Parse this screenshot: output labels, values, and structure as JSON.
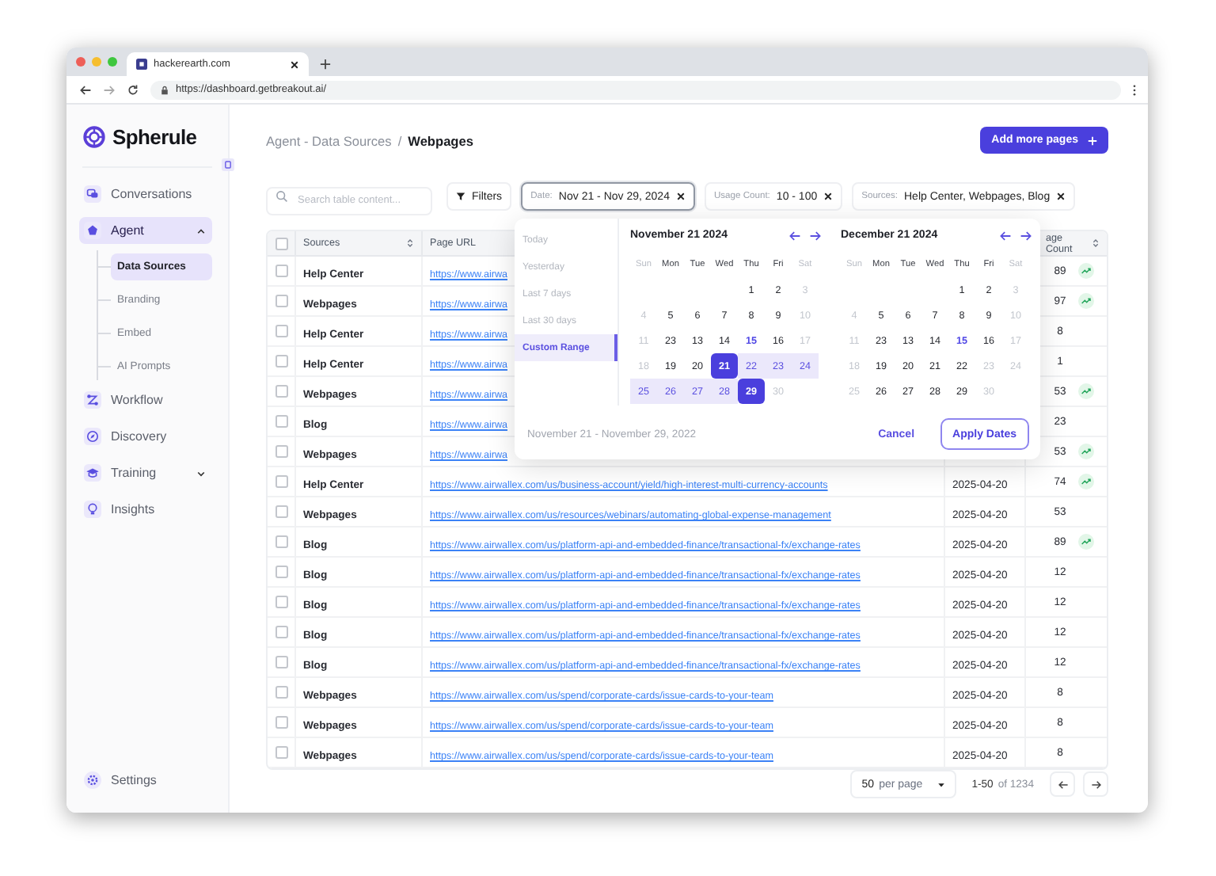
{
  "browser": {
    "tab_title": "hackerearth.com",
    "url": "https://dashboard.getbreakout.ai/"
  },
  "sidebar": {
    "brand": "Spherule",
    "items": [
      {
        "label": "Conversations",
        "selected": false
      },
      {
        "label": "Agent",
        "selected": true,
        "expanded": true,
        "children": [
          {
            "label": "Data Sources",
            "selected": true
          },
          {
            "label": "Branding",
            "selected": false
          },
          {
            "label": "Embed",
            "selected": false
          },
          {
            "label": "AI Prompts",
            "selected": false
          }
        ]
      },
      {
        "label": "Workflow",
        "selected": false
      },
      {
        "label": "Discovery",
        "selected": false
      },
      {
        "label": "Training",
        "selected": false,
        "expanded": false
      },
      {
        "label": "Insights",
        "selected": false
      }
    ],
    "settings": "Settings"
  },
  "header": {
    "breadcrumb": "Agent - Data Sources",
    "separator": "/",
    "current": "Webpages",
    "add_button": "Add more pages"
  },
  "filters": {
    "search_placeholder": "Search table content...",
    "filters_button": "Filters",
    "chips": [
      {
        "key": "Date:",
        "value": "Nov 21 - Nov 29, 2024",
        "selected": true
      },
      {
        "key": "Usage Count:",
        "value": "10 - 100",
        "selected": false
      },
      {
        "key": "Sources:",
        "value": "Help Center, Webpages, Blog",
        "selected": false
      }
    ]
  },
  "date_picker": {
    "presets": [
      {
        "label": "Today",
        "selected": false
      },
      {
        "label": "Yesterday",
        "selected": false
      },
      {
        "label": "Last 7 days",
        "selected": false
      },
      {
        "label": "Last 30 days",
        "selected": false
      },
      {
        "label": "Custom Range",
        "selected": true
      }
    ],
    "calendars": [
      {
        "title": "November 21 2024",
        "weekdays": [
          {
            "label": "Sun",
            "muted": true
          },
          {
            "label": "Mon",
            "muted": false
          },
          {
            "label": "Tue",
            "muted": false
          },
          {
            "label": "Wed",
            "muted": false
          },
          {
            "label": "Thu",
            "muted": false
          },
          {
            "label": "Fri",
            "muted": false
          },
          {
            "label": "Sat",
            "muted": true
          }
        ],
        "weeks": [
          [
            {
              "d": "1",
              "kind": "normal"
            },
            {
              "d": "2",
              "kind": "normal"
            },
            {
              "d": "3",
              "kind": "muted"
            }
          ],
          [
            {
              "d": "4",
              "kind": "muted"
            },
            {
              "d": "5",
              "kind": "normal"
            },
            {
              "d": "6",
              "kind": "normal"
            },
            {
              "d": "7",
              "kind": "normal"
            },
            {
              "d": "8",
              "kind": "normal"
            },
            {
              "d": "9",
              "kind": "normal"
            },
            {
              "d": "10",
              "kind": "muted"
            }
          ],
          [
            {
              "d": "11",
              "kind": "muted"
            },
            {
              "d": "23",
              "kind": "normal"
            },
            {
              "d": "13",
              "kind": "normal"
            },
            {
              "d": "14",
              "kind": "normal"
            },
            {
              "d": "15",
              "kind": "today"
            },
            {
              "d": "16",
              "kind": "normal"
            },
            {
              "d": "17",
              "kind": "muted"
            }
          ],
          [
            {
              "d": "18",
              "kind": "muted"
            },
            {
              "d": "19",
              "kind": "normal"
            },
            {
              "d": "20",
              "kind": "normal"
            },
            {
              "d": "21",
              "kind": "start"
            },
            {
              "d": "22",
              "kind": "range"
            },
            {
              "d": "23",
              "kind": "range"
            },
            {
              "d": "24",
              "kind": "range"
            }
          ],
          [
            {
              "d": "25",
              "kind": "range"
            },
            {
              "d": "26",
              "kind": "range"
            },
            {
              "d": "27",
              "kind": "range"
            },
            {
              "d": "28",
              "kind": "range"
            },
            {
              "d": "29",
              "kind": "end"
            },
            {
              "d": "30",
              "kind": "muted"
            }
          ]
        ]
      },
      {
        "title": "December 21 2024",
        "weekdays": [
          {
            "label": "Sun",
            "muted": true
          },
          {
            "label": "Mon",
            "muted": false
          },
          {
            "label": "Tue",
            "muted": false
          },
          {
            "label": "Wed",
            "muted": false
          },
          {
            "label": "Thu",
            "muted": false
          },
          {
            "label": "Fri",
            "muted": false
          },
          {
            "label": "Sat",
            "muted": true
          }
        ],
        "weeks": [
          [
            {
              "d": "1",
              "kind": "normal"
            },
            {
              "d": "2",
              "kind": "normal"
            },
            {
              "d": "3",
              "kind": "muted"
            }
          ],
          [
            {
              "d": "4",
              "kind": "muted"
            },
            {
              "d": "5",
              "kind": "normal"
            },
            {
              "d": "6",
              "kind": "normal"
            },
            {
              "d": "7",
              "kind": "normal"
            },
            {
              "d": "8",
              "kind": "normal"
            },
            {
              "d": "9",
              "kind": "normal"
            },
            {
              "d": "10",
              "kind": "muted"
            }
          ],
          [
            {
              "d": "11",
              "kind": "muted"
            },
            {
              "d": "23",
              "kind": "normal"
            },
            {
              "d": "13",
              "kind": "normal"
            },
            {
              "d": "14",
              "kind": "normal"
            },
            {
              "d": "15",
              "kind": "today"
            },
            {
              "d": "16",
              "kind": "normal"
            },
            {
              "d": "17",
              "kind": "muted"
            }
          ],
          [
            {
              "d": "18",
              "kind": "muted"
            },
            {
              "d": "19",
              "kind": "normal"
            },
            {
              "d": "20",
              "kind": "normal"
            },
            {
              "d": "21",
              "kind": "normal"
            },
            {
              "d": "22",
              "kind": "normal"
            },
            {
              "d": "23",
              "kind": "muted"
            },
            {
              "d": "24",
              "kind": "muted"
            }
          ],
          [
            {
              "d": "25",
              "kind": "muted"
            },
            {
              "d": "26",
              "kind": "normal"
            },
            {
              "d": "27",
              "kind": "normal"
            },
            {
              "d": "28",
              "kind": "normal"
            },
            {
              "d": "29",
              "kind": "normal"
            },
            {
              "d": "30",
              "kind": "muted"
            }
          ]
        ]
      }
    ],
    "range_text": "November 21 - November 29, 2022",
    "cancel": "Cancel",
    "apply": "Apply Dates"
  },
  "table": {
    "header_checkbox": {
      "checked": false
    },
    "columns": [
      {
        "label": "Sources",
        "sortable": true
      },
      {
        "label": "Page URL",
        "sortable": false
      },
      {
        "label": "age Count",
        "sortable": true
      }
    ],
    "rows": [
      {
        "checked": false,
        "source": "Help Center",
        "url": "https://www.airwa",
        "count": "89",
        "trending": true
      },
      {
        "checked": false,
        "source": "Webpages",
        "url": "https://www.airwa",
        "count": "97",
        "trending": true
      },
      {
        "checked": false,
        "source": "Help Center",
        "url": "https://www.airwa",
        "count": "8",
        "trending": false
      },
      {
        "checked": false,
        "source": "Help Center",
        "url": "https://www.airwa",
        "count": "1",
        "trending": false
      },
      {
        "checked": false,
        "source": "Webpages",
        "url": "https://www.airwa",
        "count": "53",
        "trending": true
      },
      {
        "checked": false,
        "source": "Blog",
        "url": "https://www.airwa",
        "count": "23",
        "trending": false
      },
      {
        "checked": false,
        "source": "Webpages",
        "url": "https://www.airwa",
        "count": "53",
        "trending": true
      },
      {
        "checked": false,
        "source": "Help Center",
        "url": "https://www.airwallex.com/us/business-account/yield/high-interest-multi-currency-accounts",
        "date": "2025-04-20",
        "count": "74",
        "trending": true
      },
      {
        "checked": false,
        "source": "Webpages",
        "url": "https://www.airwallex.com/us/resources/webinars/automating-global-expense-management",
        "date": "2025-04-20",
        "count": "53",
        "trending": false
      },
      {
        "checked": false,
        "source": "Blog",
        "url": "https://www.airwallex.com/us/platform-api-and-embedded-finance/transactional-fx/exchange-rates",
        "date": "2025-04-20",
        "count": "89",
        "trending": true
      },
      {
        "checked": false,
        "source": "Blog",
        "url": "https://www.airwallex.com/us/platform-api-and-embedded-finance/transactional-fx/exchange-rates",
        "date": "2025-04-20",
        "count": "12",
        "trending": false
      },
      {
        "checked": false,
        "source": "Blog",
        "url": "https://www.airwallex.com/us/platform-api-and-embedded-finance/transactional-fx/exchange-rates",
        "date": "2025-04-20",
        "count": "12",
        "trending": false
      },
      {
        "checked": false,
        "source": "Blog",
        "url": "https://www.airwallex.com/us/platform-api-and-embedded-finance/transactional-fx/exchange-rates",
        "date": "2025-04-20",
        "count": "12",
        "trending": false
      },
      {
        "checked": false,
        "source": "Blog",
        "url": "https://www.airwallex.com/us/platform-api-and-embedded-finance/transactional-fx/exchange-rates",
        "date": "2025-04-20",
        "count": "12",
        "trending": false
      },
      {
        "checked": false,
        "source": "Webpages",
        "url": "https://www.airwallex.com/us/spend/corporate-cards/issue-cards-to-your-team",
        "date": "2025-04-20",
        "count": "8",
        "trending": false
      },
      {
        "checked": false,
        "source": "Webpages",
        "url": "https://www.airwallex.com/us/spend/corporate-cards/issue-cards-to-your-team",
        "date": "2025-04-20",
        "count": "8",
        "trending": false
      },
      {
        "checked": false,
        "source": "Webpages",
        "url": "https://www.airwallex.com/us/spend/corporate-cards/issue-cards-to-your-team",
        "date": "2025-04-20",
        "count": "8",
        "trending": false
      }
    ]
  },
  "pagination": {
    "per_page": "50",
    "per_page_label": "per page",
    "range": "1-50",
    "total": "of 1234"
  }
}
